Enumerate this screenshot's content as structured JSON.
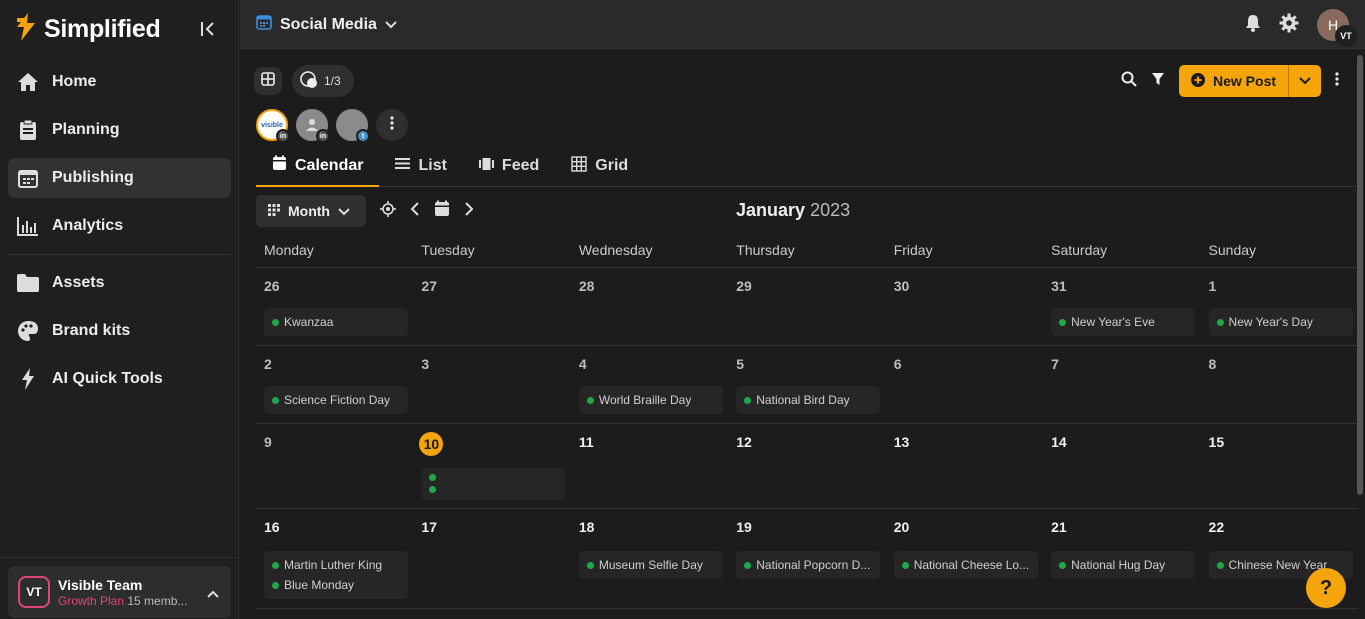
{
  "brand": {
    "name": "Simplified",
    "accent": "#f5a40a"
  },
  "sidebar": {
    "items": [
      {
        "label": "Home",
        "icon": "home-icon"
      },
      {
        "label": "Planning",
        "icon": "clipboard-icon"
      },
      {
        "label": "Publishing",
        "icon": "calendar-icon"
      },
      {
        "label": "Analytics",
        "icon": "bar-chart-icon"
      },
      {
        "label": "Assets",
        "icon": "folder-icon"
      },
      {
        "label": "Brand kits",
        "icon": "palette-icon"
      },
      {
        "label": "AI Quick Tools",
        "icon": "lightning-icon"
      }
    ],
    "team": {
      "initials": "VT",
      "name": "Visible Team",
      "plan": "Growth Plan",
      "members": "15 memb..."
    }
  },
  "topbar": {
    "workspace": "Social Media",
    "user_initial": "H",
    "user_badge": "VT"
  },
  "toolbar": {
    "count": "1/3",
    "new_post": "New Post",
    "account_label": "visible"
  },
  "tabs": [
    {
      "label": "Calendar"
    },
    {
      "label": "List"
    },
    {
      "label": "Feed"
    },
    {
      "label": "Grid"
    }
  ],
  "calendar": {
    "view": "Month",
    "month": "January",
    "year": "2023",
    "weekdays": [
      "Monday",
      "Tuesday",
      "Wednesday",
      "Thursday",
      "Friday",
      "Saturday",
      "Sunday"
    ],
    "weeks": [
      {
        "days": [
          "26",
          "27",
          "28",
          "29",
          "30",
          "31",
          "1"
        ]
      },
      {
        "days": [
          "2",
          "3",
          "4",
          "5",
          "6",
          "7",
          "8"
        ]
      },
      {
        "days": [
          "9",
          "10",
          "11",
          "12",
          "13",
          "14",
          "15"
        ]
      },
      {
        "days": [
          "16",
          "17",
          "18",
          "19",
          "20",
          "21",
          "22"
        ]
      }
    ],
    "events": {
      "w0": {
        "mon": "Kwanzaa",
        "sat": "New Year's Eve",
        "sun": "New Year's Day"
      },
      "w1": {
        "mon": "Science Fiction Day",
        "wed": "World Braille Day",
        "thu": "National Bird Day"
      },
      "w3": {
        "mon1": "Martin Luther King",
        "mon2": "Blue Monday",
        "wed": "Museum Selfie Day",
        "thu": "National Popcorn D...",
        "fri": "National Cheese Lo...",
        "sat": "National Hug Day",
        "sun": "Chinese New Year"
      }
    }
  },
  "help": "?"
}
